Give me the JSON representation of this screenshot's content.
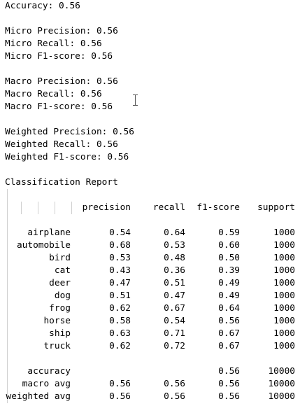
{
  "summary": {
    "accuracy": "Accuracy: 0.56",
    "micro_precision": "Micro Precision: 0.56",
    "micro_recall": "Micro Recall: 0.56",
    "micro_f1": "Micro F1-score: 0.56",
    "macro_precision": "Macro Precision: 0.56",
    "macro_recall": "Macro Recall: 0.56",
    "macro_f1": "Macro F1-score: 0.56",
    "weighted_precision": "Weighted Precision: 0.56",
    "weighted_recall": "Weighted Recall: 0.56",
    "weighted_f1": "Weighted F1-score: 0.56"
  },
  "report": {
    "title": "Classification Report",
    "headers": [
      "precision",
      "recall",
      "f1-score",
      "support"
    ],
    "rows": [
      {
        "label": "airplane",
        "precision": "0.54",
        "recall": "0.64",
        "f1": "0.59",
        "support": "1000"
      },
      {
        "label": "automobile",
        "precision": "0.68",
        "recall": "0.53",
        "f1": "0.60",
        "support": "1000"
      },
      {
        "label": "bird",
        "precision": "0.53",
        "recall": "0.48",
        "f1": "0.50",
        "support": "1000"
      },
      {
        "label": "cat",
        "precision": "0.43",
        "recall": "0.36",
        "f1": "0.39",
        "support": "1000"
      },
      {
        "label": "deer",
        "precision": "0.47",
        "recall": "0.51",
        "f1": "0.49",
        "support": "1000"
      },
      {
        "label": "dog",
        "precision": "0.51",
        "recall": "0.47",
        "f1": "0.49",
        "support": "1000"
      },
      {
        "label": "frog",
        "precision": "0.62",
        "recall": "0.67",
        "f1": "0.64",
        "support": "1000"
      },
      {
        "label": "horse",
        "precision": "0.58",
        "recall": "0.54",
        "f1": "0.56",
        "support": "1000"
      },
      {
        "label": "ship",
        "precision": "0.63",
        "recall": "0.71",
        "f1": "0.67",
        "support": "1000"
      },
      {
        "label": "truck",
        "precision": "0.62",
        "recall": "0.72",
        "f1": "0.67",
        "support": "1000"
      }
    ],
    "totals": [
      {
        "label": "accuracy",
        "precision": "",
        "recall": "",
        "f1": "0.56",
        "support": "10000"
      },
      {
        "label": "macro avg",
        "precision": "0.56",
        "recall": "0.56",
        "f1": "0.56",
        "support": "10000"
      },
      {
        "label": "weighted avg",
        "precision": "0.56",
        "recall": "0.56",
        "f1": "0.56",
        "support": "10000"
      }
    ]
  }
}
